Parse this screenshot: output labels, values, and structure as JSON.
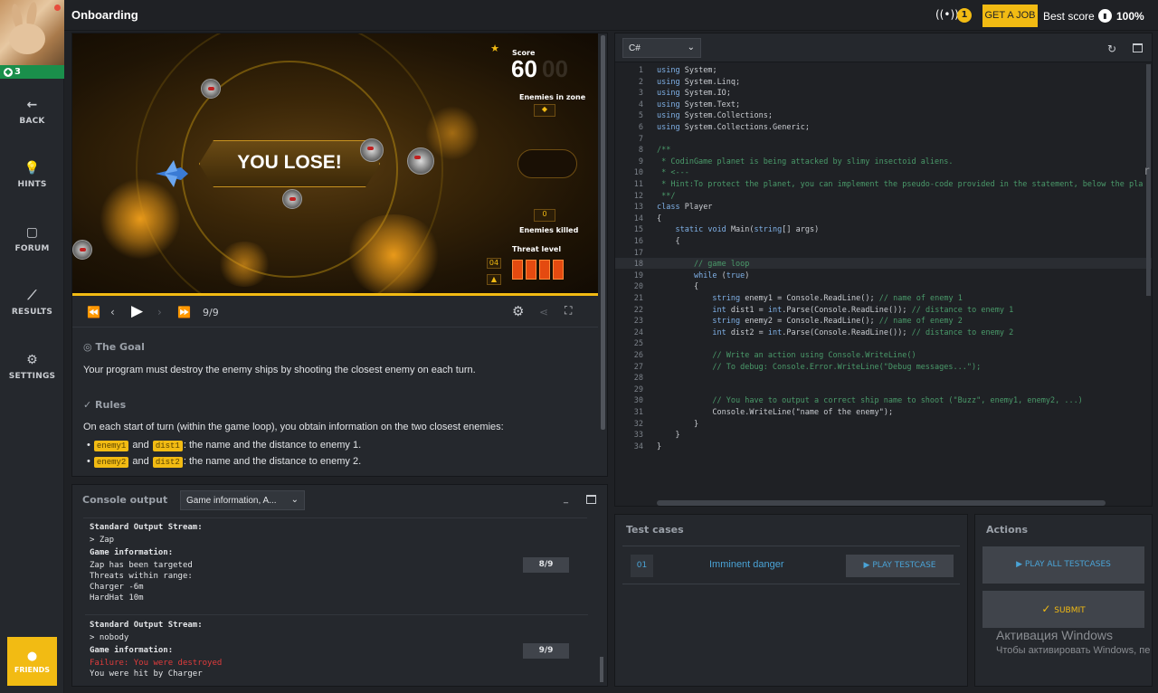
{
  "header": {
    "title": "Onboarding",
    "radio_count": "1",
    "get_job_label": "GET A JOB",
    "best_score_label": "Best score",
    "best_score_value": "100%"
  },
  "sidebar": {
    "level": "3",
    "items": [
      {
        "label": "BACK",
        "icon": "arrow-left-icon"
      },
      {
        "label": "HINTS",
        "icon": "lightbulb-icon"
      },
      {
        "label": "FORUM",
        "icon": "forum-icon"
      },
      {
        "label": "RESULTS",
        "icon": "chart-icon"
      },
      {
        "label": "SETTINGS",
        "icon": "gear-icon"
      }
    ],
    "friends_label": "FRIENDS"
  },
  "game": {
    "score_label": "Score",
    "score_value": "60",
    "score_bg": "00",
    "message": "YOU LOSE!",
    "enemies_in_zone_label": "Enemies in zone",
    "enemies_killed_label": "Enemies killed",
    "enemies_killed_value": "0",
    "threat_label": "Threat level",
    "threat_value": "04",
    "threat_level": 4
  },
  "player": {
    "frame": "9/9"
  },
  "statement": {
    "goal_title": "The Goal",
    "goal_text": "Your program must destroy the enemy ships by shooting the closest enemy on each turn.",
    "rules_title": "Rules",
    "rules_text": "On each start of turn (within the game loop), you obtain information on the two closest enemies:",
    "bullets": [
      {
        "var1": "enemy1",
        "and": "and",
        "var2": "dist1",
        "text": ": the name and the distance to enemy 1."
      },
      {
        "var1": "enemy2",
        "and": "and",
        "var2": "dist2",
        "text": ": the name and the distance to enemy 2."
      }
    ]
  },
  "console": {
    "title": "Console output",
    "filter": "Game information, A...",
    "blocks": [
      {
        "stream_title": "Standard Output Stream:",
        "stream_value": "> Zap",
        "info_title": "Game information:",
        "lines": [
          "Zap has been targeted",
          "Threats within range:",
          "Charger -6m",
          "HardHat 10m"
        ],
        "turn": "8/9"
      },
      {
        "stream_title": "Standard Output Stream:",
        "stream_value": "> nobody",
        "info_title": "Game information:",
        "error_line": "Failure: You were destroyed",
        "lines": [
          "You were hit by Charger"
        ],
        "turn": "9/9"
      }
    ]
  },
  "editor": {
    "language": "C#",
    "lines": [
      "using System;",
      "using System.Linq;",
      "using System.IO;",
      "using System.Text;",
      "using System.Collections;",
      "using System.Collections.Generic;",
      "",
      "/**",
      " * CodinGame planet is being attacked by slimy insectoid aliens.",
      " * <---",
      " * Hint:To protect the planet, you can implement the pseudo-code provided in the statement, below the pla",
      " **/",
      "class Player",
      "{",
      "    static void Main(string[] args)",
      "    {",
      "",
      "        // game loop",
      "        while (true)",
      "        {",
      "            string enemy1 = Console.ReadLine(); // name of enemy 1",
      "            int dist1 = int.Parse(Console.ReadLine()); // distance to enemy 1",
      "            string enemy2 = Console.ReadLine(); // name of enemy 2",
      "            int dist2 = int.Parse(Console.ReadLine()); // distance to enemy 2",
      "",
      "            // Write an action using Console.WriteLine()",
      "            // To debug: Console.Error.WriteLine(\"Debug messages...\");",
      "",
      "",
      "            // You have to output a correct ship name to shoot (\"Buzz\", enemy1, enemy2, ...)",
      "            Console.WriteLine(\"name of the enemy\");",
      "        }",
      "    }",
      "}"
    ]
  },
  "tests": {
    "title": "Test cases",
    "items": [
      {
        "num": "01",
        "name": "Imminent danger",
        "play_label": "PLAY TESTCASE"
      }
    ]
  },
  "actions": {
    "title": "Actions",
    "play_all_label": "PLAY ALL TESTCASES",
    "submit_label": "SUBMIT"
  },
  "watermark": {
    "line1": "Активация Windows",
    "line2": "Чтобы активировать Windows, пе"
  }
}
